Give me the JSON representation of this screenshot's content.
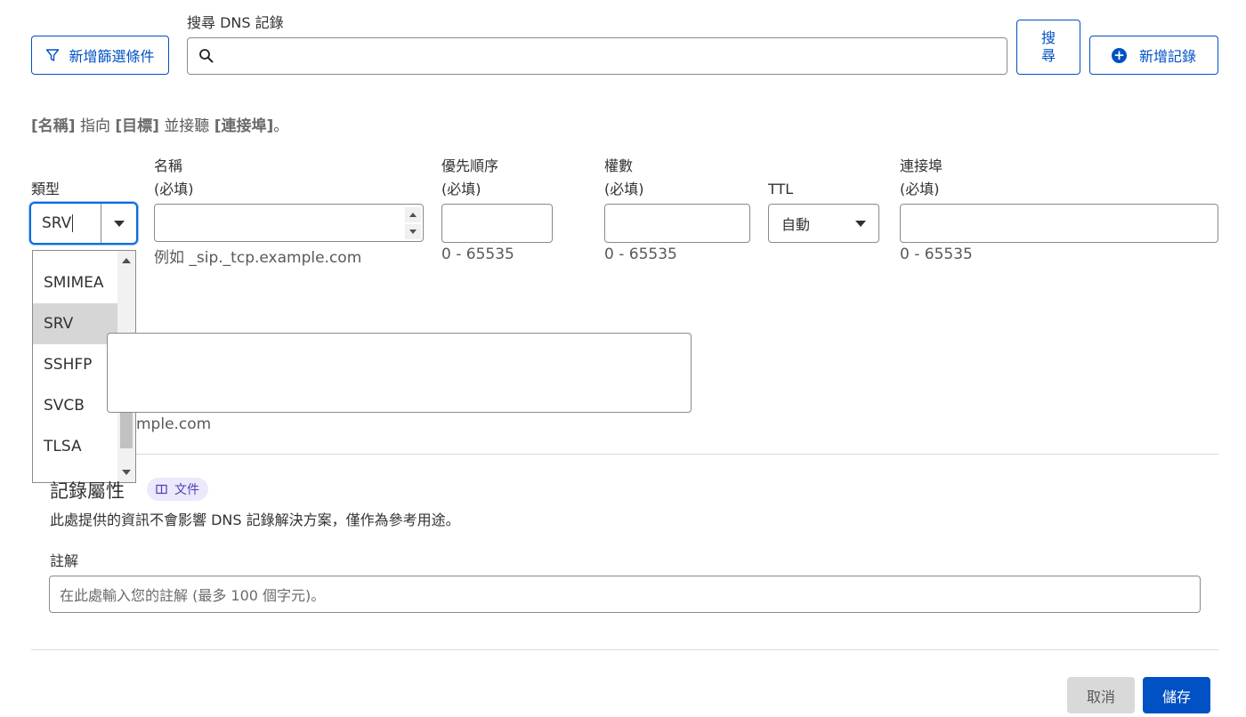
{
  "toolbar": {
    "filter_button": "新增篩選條件",
    "search_label": "搜尋 DNS 記錄",
    "search_button_line1": "搜",
    "search_button_line2": "尋",
    "add_record_button": "新增記錄"
  },
  "description": {
    "name": "[名稱]",
    "points_to": " 指向 ",
    "target": "[目標]",
    "and_listens": " 並接聽 ",
    "port": "[連接埠]",
    "end": "。"
  },
  "fields": {
    "type": {
      "label": "類型",
      "value": "SRV"
    },
    "name": {
      "label": "名稱",
      "required": "(必填)",
      "hint": "例如 _sip._tcp.example.com"
    },
    "priority": {
      "label": "優先順序",
      "required": "(必填)",
      "hint": "0 - 65535"
    },
    "weight": {
      "label": "權數",
      "required": "(必填)",
      "hint": "0 - 65535"
    },
    "ttl": {
      "label": "TTL",
      "value": "自動"
    },
    "port": {
      "label": "連接埠",
      "required": "(必填)",
      "hint": "0 - 65535"
    },
    "target": {
      "hint_partial": "mple.com"
    }
  },
  "type_dropdown": {
    "options": [
      "SMIMEA",
      "SRV",
      "SSHFP",
      "SVCB",
      "TLSA"
    ],
    "selected": "SRV"
  },
  "record_attributes": {
    "title": "記錄屬性",
    "doc_badge": "文件",
    "description": "此處提供的資訊不會影響 DNS 記錄解決方案，僅作為參考用途。",
    "comment_label": "註解",
    "comment_placeholder": "在此處輸入您的註解 (最多 100 個字元)。"
  },
  "footer": {
    "cancel": "取消",
    "save": "儲存"
  },
  "colors": {
    "accent": "#0051c3",
    "focus": "#0a6cdf",
    "badge_bg": "#ebe9fb"
  }
}
